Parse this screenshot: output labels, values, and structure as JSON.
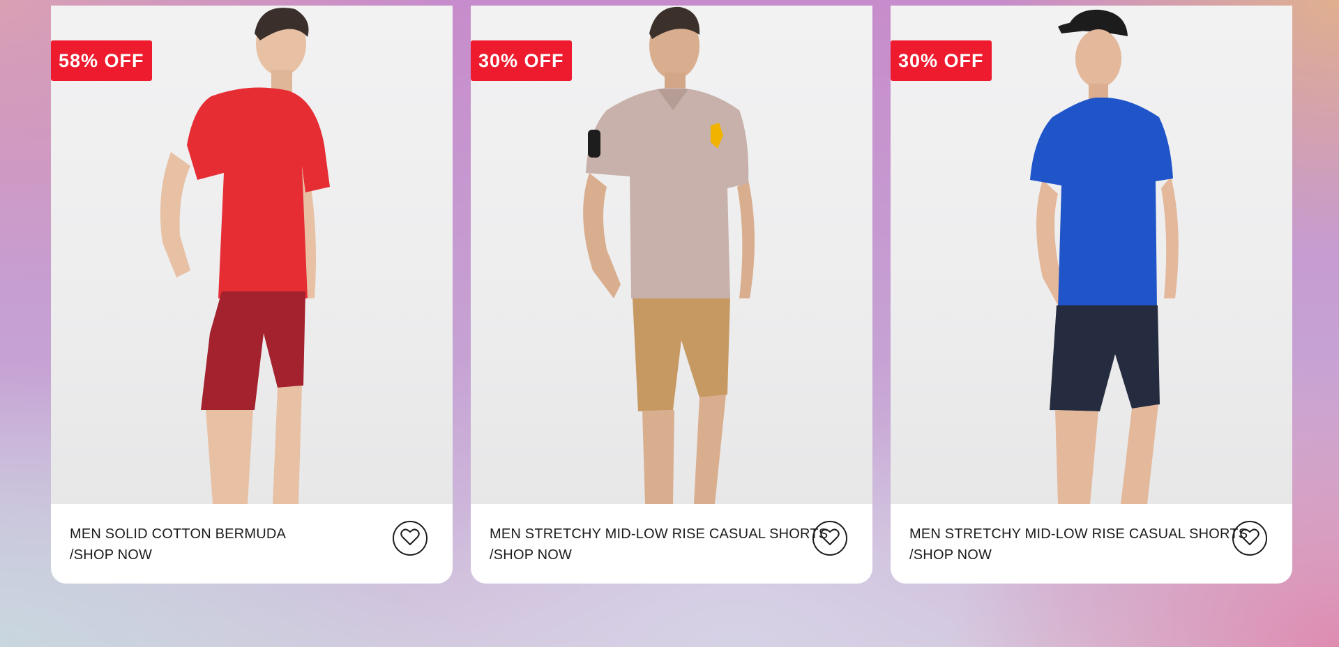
{
  "products": [
    {
      "discount": "58% OFF",
      "title": "MEN SOLID COTTON BERMUDA",
      "cta": "/SHOP NOW",
      "icon": "heart-icon",
      "colors": {
        "shirt": "#e62d34",
        "shorts": "#a3222e"
      }
    },
    {
      "discount": "30% OFF",
      "title": "MEN STRETCHY MID-LOW RISE CASUAL SHORTS",
      "cta": "/SHOP NOW",
      "icon": "heart-icon",
      "colors": {
        "shirt": "#c7b1aa",
        "shorts": "#c69963"
      }
    },
    {
      "discount": "30% OFF",
      "title": "MEN STRETCHY MID-LOW RISE CASUAL SHORTS",
      "cta": "/SHOP NOW",
      "icon": "heart-icon",
      "colors": {
        "shirt": "#1f55c8",
        "shorts": "#262c40"
      }
    }
  ],
  "theme": {
    "badge": "#ee1a2e",
    "text": "#1b1b1b"
  }
}
